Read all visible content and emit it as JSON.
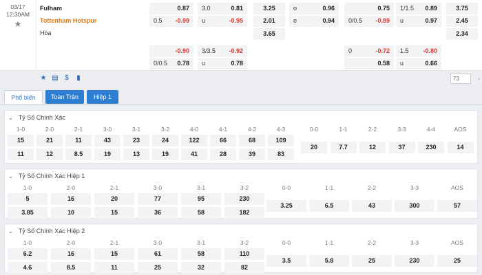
{
  "match": {
    "date": "03/17",
    "time": "12:30AM",
    "home": "Fulham",
    "away": "Tottenham Hotspur",
    "draw": "Hòa",
    "ah1": [
      {
        "l": "",
        "r": "0.87"
      },
      {
        "l": "0.5",
        "r": "-0.99"
      }
    ],
    "ou1": [
      {
        "l": "3.0",
        "r": "0.81"
      },
      {
        "l": "u",
        "r": "-0.95"
      }
    ],
    "x12": [
      "3.25",
      "2.01",
      "3.65"
    ],
    "oe": [
      {
        "l": "o",
        "r": "0.96"
      },
      {
        "l": "e",
        "r": "0.94"
      }
    ],
    "ah_h1": [
      {
        "l": "",
        "r": "0.75"
      },
      {
        "l": "0/0.5",
        "r": "-0.89"
      }
    ],
    "ou_h1": [
      {
        "l": "1/1.5",
        "r": "0.89"
      },
      {
        "l": "u",
        "r": "0.97"
      }
    ],
    "x12_h1": [
      "3.75",
      "2.45",
      "2.34"
    ],
    "ah2": [
      {
        "l": "",
        "r": "-0.90"
      },
      {
        "l": "0/0.5",
        "r": "0.78"
      }
    ],
    "ou2": [
      {
        "l": "3/3.5",
        "r": "-0.92"
      },
      {
        "l": "u",
        "r": "0.78"
      }
    ],
    "ah_h2": [
      {
        "l": "0",
        "r": "-0.72"
      },
      {
        "l": "",
        "r": "0.58"
      }
    ],
    "ou_h2": [
      {
        "l": "1.5",
        "r": "-0.80"
      },
      {
        "l": "u",
        "r": "0.66"
      }
    ],
    "count": "73",
    "toolbar_icons": [
      "star-icon",
      "list-icon",
      "dollar-icon",
      "bar-chart-icon"
    ]
  },
  "tabs": [
    "Phổ biến",
    "Toàn Trận",
    "Hiệp 1"
  ],
  "sections": [
    {
      "title": "Tỷ Số Chính Xác",
      "left_headers": [
        "1-0",
        "2-0",
        "2-1",
        "3-0",
        "3-1",
        "3-2",
        "4-0",
        "4-1",
        "4-2",
        "4-3"
      ],
      "left_row1": [
        "15",
        "21",
        "11",
        "43",
        "23",
        "24",
        "122",
        "66",
        "68",
        "109"
      ],
      "left_row2": [
        "11",
        "12",
        "8.5",
        "19",
        "13",
        "19",
        "41",
        "28",
        "39",
        "83"
      ],
      "right_headers": [
        "0-0",
        "1-1",
        "2-2",
        "3-3",
        "4-4",
        "AOS"
      ],
      "right_row": [
        "20",
        "7.7",
        "12",
        "37",
        "230",
        "14"
      ]
    },
    {
      "title": "Tỷ Số Chính Xác Hiệp 1",
      "left_headers": [
        "1-0",
        "2-0",
        "2-1",
        "3-0",
        "3-1",
        "3-2"
      ],
      "left_row1": [
        "5",
        "16",
        "20",
        "77",
        "95",
        "230"
      ],
      "left_row2": [
        "3.85",
        "10",
        "15",
        "36",
        "58",
        "182"
      ],
      "right_headers": [
        "0-0",
        "1-1",
        "2-2",
        "3-3",
        "AOS"
      ],
      "right_row": [
        "3.25",
        "6.5",
        "43",
        "300",
        "57"
      ]
    },
    {
      "title": "Tỷ Số Chính Xác Hiệp 2",
      "left_headers": [
        "1-0",
        "2-0",
        "2-1",
        "3-0",
        "3-1",
        "3-2"
      ],
      "left_row1": [
        "6.2",
        "16",
        "15",
        "61",
        "58",
        "110"
      ],
      "left_row2": [
        "4.6",
        "8.5",
        "11",
        "25",
        "32",
        "82"
      ],
      "right_headers": [
        "0-0",
        "1-1",
        "2-2",
        "3-3",
        "AOS"
      ],
      "right_row": [
        "3.5",
        "5.8",
        "25",
        "230",
        "25"
      ]
    }
  ]
}
